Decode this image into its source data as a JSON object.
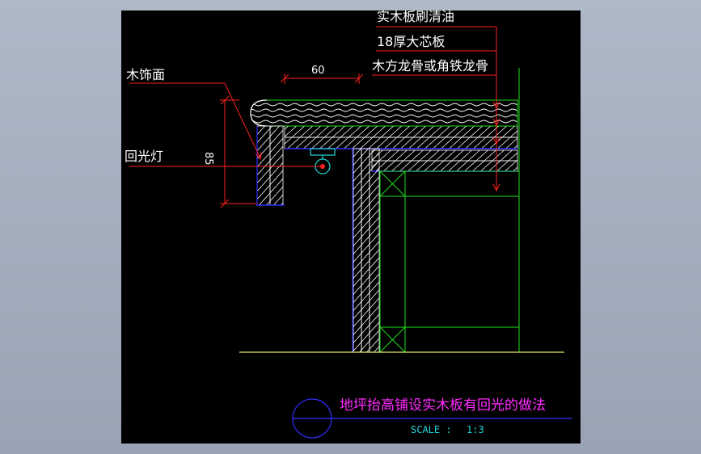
{
  "drawing": {
    "labels": {
      "wood_top": "实木板刷清油",
      "blockboard": "18厚大芯板",
      "keel": "木方龙骨或角铁龙骨",
      "wood_finish": "木饰面",
      "backlight": "回光灯"
    },
    "dimensions": {
      "width": "60",
      "height": "85"
    },
    "title": "地坪抬高铺设实木板有回光的做法",
    "scale_label": "SCALE :",
    "scale_value": "1:3"
  },
  "colors": {
    "background": "#000000",
    "window": "#9aa3b3",
    "leader": "#ff2020",
    "board": "#ffffff",
    "frame": "#22dd22",
    "edge_blue": "#3030ff",
    "floor": "#e8e85a",
    "title": "#ff2cff",
    "scale": "#20d8d8"
  }
}
